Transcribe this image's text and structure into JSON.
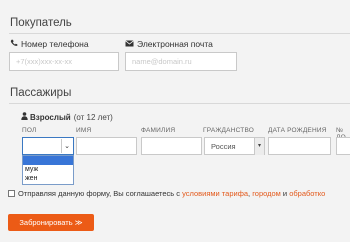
{
  "buyer": {
    "title": "Покупатель",
    "phone_label": "Номер телефона",
    "phone_placeholder": "+7(ххх)ххх-хх-хх",
    "email_label": "Электронная почта",
    "email_placeholder": "name@domain.ru"
  },
  "passengers": {
    "title": "Пассажиры",
    "type_label": "Взрослый",
    "type_note": "(от 12 лет)",
    "columns": {
      "gender": "ПОЛ",
      "name": "ИМЯ",
      "surname": "ФАМИЛИЯ",
      "citizenship": "ГРАЖДАНСТВО",
      "birthdate": "ДАТА РОЖДЕНИЯ",
      "doc": "№ ДО"
    },
    "gender_dropdown": {
      "value": "",
      "options": [
        "",
        "муж",
        "жен"
      ],
      "highlighted_index": 0
    },
    "citizenship_value": "Россия"
  },
  "agreement": {
    "text": "Отправляя данную форму, Вы соглашаетесь с условиями тарифа,",
    "link1": "условиями тарифа",
    "text_prefix": "Отправляя данную форму, Вы соглашаетесь с ",
    "sep": ", ",
    "link2": "городом",
    "and": " и ",
    "link3": "обработко"
  },
  "submit": {
    "label": "Забронировать ≫"
  },
  "colors": {
    "accent": "#ec5b16",
    "link": "#e35a1c",
    "focus": "#3a78c2"
  },
  "icons": {
    "phone": "phone-icon",
    "email": "email-icon",
    "person": "person-icon"
  }
}
